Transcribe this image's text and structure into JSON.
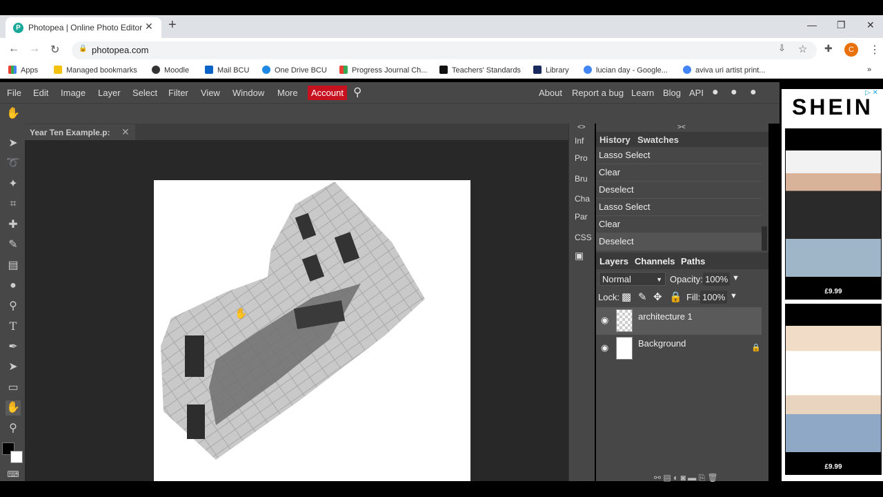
{
  "browser": {
    "tab_title": "Photopea | Online Photo Editor",
    "tab_favicon": "P",
    "url": "photopea.com",
    "profile_initial": "C",
    "bookmarks": [
      "Apps",
      "Managed bookmarks",
      "Moodle",
      "Mail BCU",
      "One Drive BCU",
      "Progress Journal Ch...",
      "Teachers' Standards",
      "Library",
      "lucian day - Google...",
      "aviva uri artist print..."
    ]
  },
  "menu": {
    "items": [
      "File",
      "Edit",
      "Image",
      "Layer",
      "Select",
      "Filter",
      "View",
      "Window",
      "More"
    ],
    "account": "Account",
    "right_links": [
      "About",
      "Report a bug",
      "Learn",
      "Blog",
      "API"
    ]
  },
  "document": {
    "tab_title": "Year Ten Example.p:"
  },
  "side_tabs": [
    "Inf",
    "Pro",
    "Bru",
    "Cha",
    "Par",
    "CSS"
  ],
  "history": {
    "tabs": [
      "History",
      "Swatches"
    ],
    "items": [
      "Lasso Select",
      "Clear",
      "Deselect",
      "Lasso Select",
      "Clear",
      "Deselect"
    ]
  },
  "layers": {
    "tabs": [
      "Layers",
      "Channels",
      "Paths"
    ],
    "blend_mode": "Normal",
    "opacity_label": "Opacity:",
    "opacity": "100%",
    "lock_label": "Lock:",
    "fill_label": "Fill:",
    "fill": "100%",
    "items": [
      "architecture 1",
      "Background"
    ]
  },
  "ad": {
    "brand": "SHEIN",
    "prices": [
      "£9.99",
      "£9.99"
    ]
  },
  "colors": {
    "accent": "#c8111f",
    "panel": "#474747",
    "workspace": "#282828"
  }
}
